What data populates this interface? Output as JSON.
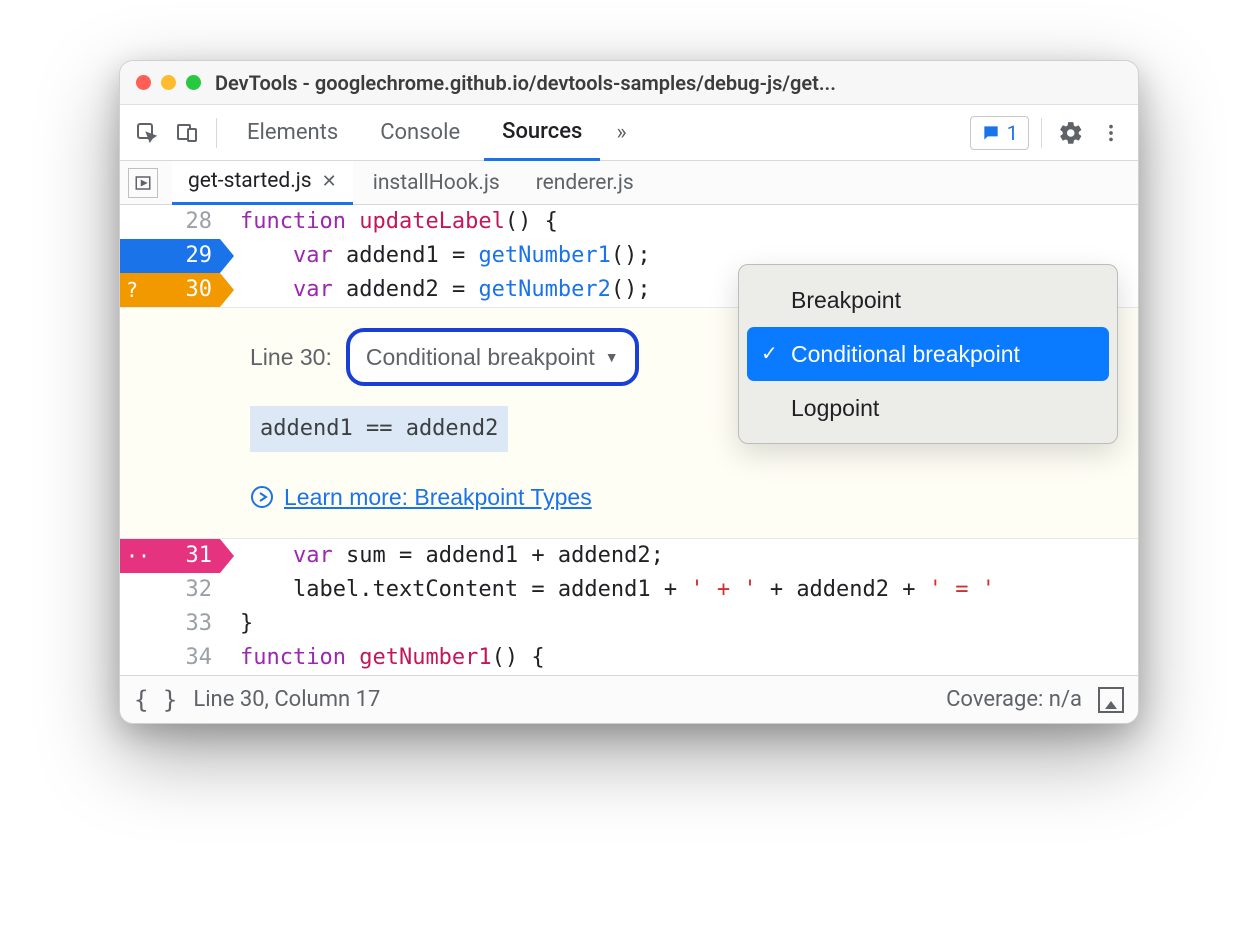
{
  "window": {
    "title": "DevTools - googlechrome.github.io/devtools-samples/debug-js/get..."
  },
  "panelTabs": {
    "elements": "Elements",
    "console": "Console",
    "sources": "Sources",
    "issuesCount": "1"
  },
  "fileTabs": {
    "active": "get-started.js",
    "tab2": "installHook.js",
    "tab3": "renderer.js"
  },
  "code": {
    "l28_num": "28",
    "l28_kw": "function",
    "l28_name": " updateLabel",
    "l28_rest": "() {",
    "l29_num": "29",
    "l29_kw": "var",
    "l29_name": " addend1 = ",
    "l29_fn": "getNumber1",
    "l29_rest": "();",
    "l30_num": "30",
    "l30_prefix": "?",
    "l30_kw": "var",
    "l30_name": " addend2 = ",
    "l30_fn": "getNumber2",
    "l30_rest": "();",
    "l31_num": "31",
    "l31_prefix": "··",
    "l31_kw": "var",
    "l31_name": " sum = addend1 + addend2;",
    "l32_num": "32",
    "l32_text1": "    label.textContent = addend1 + ",
    "l32_str1": "' + '",
    "l32_text2": " + addend2 + ",
    "l32_str2": "' = '",
    "l33_num": "33",
    "l33_text": "}",
    "l34_num": "34",
    "l34_kw": "function",
    "l34_name": " getNumber1",
    "l34_rest": "() {"
  },
  "bpEditor": {
    "lineLabel": "Line 30:",
    "selectLabel": "Conditional breakpoint",
    "condition": "addend1 == addend2",
    "learnMore": "Learn more: Breakpoint Types"
  },
  "menu": {
    "item1": "Breakpoint",
    "item2": "Conditional breakpoint",
    "item3": "Logpoint"
  },
  "status": {
    "position": "Line 30, Column 17",
    "coverage": "Coverage: n/a"
  }
}
